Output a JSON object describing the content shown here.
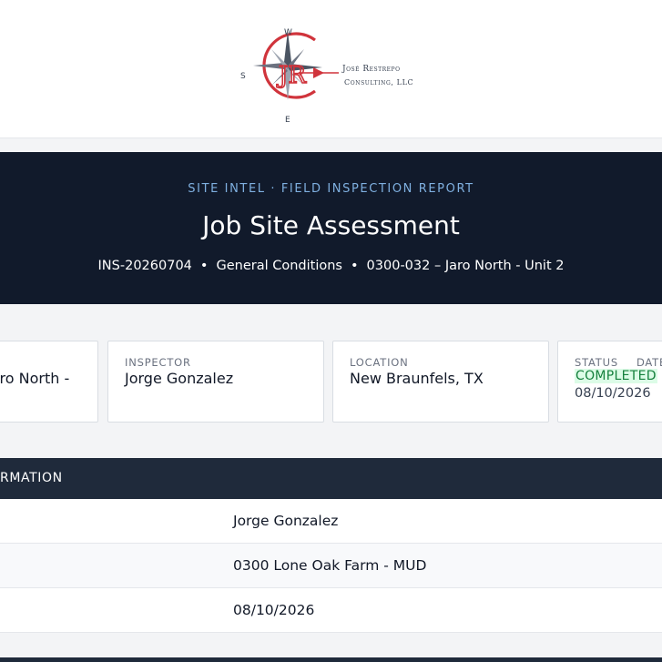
{
  "brand": {
    "name": "José Restrepo",
    "sub": "Consulting, LLC",
    "compass_w": "W",
    "compass_s": "S",
    "compass_e": "E",
    "monogram": "JR"
  },
  "hero": {
    "eyebrow": "SITE INTEL · FIELD INSPECTION REPORT",
    "title": "Job Site Assessment",
    "meta": [
      "INS-20260704",
      "General Conditions",
      "0300-032 – Jaro North - Unit 2"
    ],
    "separator": "•"
  },
  "cards": [
    {
      "label": "",
      "value": "Jaro North -"
    },
    {
      "label": "INSPECTOR",
      "value": "Jorge Gonzalez"
    },
    {
      "label": "LOCATION",
      "value": "New Braunfels, TX"
    },
    {
      "label": "STATUS",
      "label2": "DATE",
      "status": "COMPLETED",
      "date": "08/10/2026"
    }
  ],
  "table": {
    "header": "RMATION",
    "rows": [
      {
        "value": "Jorge Gonzalez"
      },
      {
        "value": "0300 Lone Oak Farm - MUD"
      },
      {
        "value": "08/10/2026"
      }
    ]
  },
  "colors": {
    "navy": "#111a2b",
    "table_header": "#1f2a3b",
    "accent_blue": "#7fb0e0",
    "logo_red": "#d0343c",
    "status_green": "#15803d"
  }
}
